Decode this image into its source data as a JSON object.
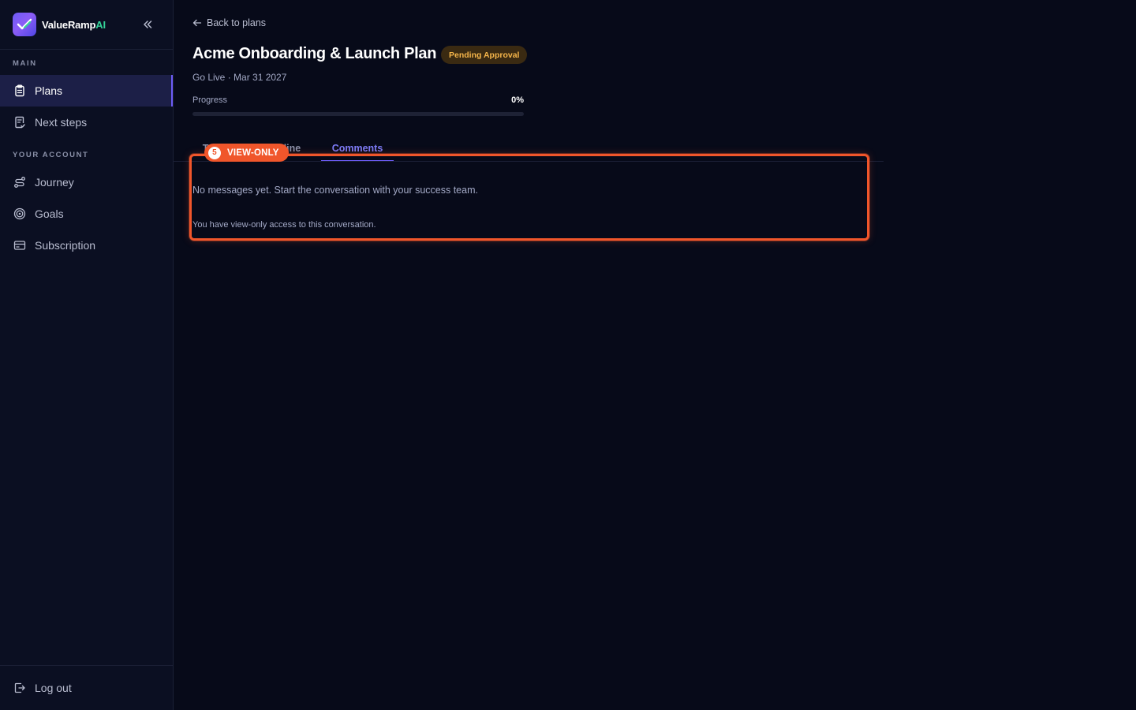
{
  "brand": {
    "name_main": "ValueRamp",
    "name_accent": "AI"
  },
  "sidebar": {
    "section_main": "MAIN",
    "section_account": "YOUR ACCOUNT",
    "items": [
      {
        "label": "Plans",
        "icon": "clipboard-icon",
        "active": true
      },
      {
        "label": "Next steps",
        "icon": "checklist-icon",
        "active": false
      },
      {
        "label": "Journey",
        "icon": "route-icon",
        "active": false
      },
      {
        "label": "Goals",
        "icon": "target-icon",
        "active": false
      },
      {
        "label": "Subscription",
        "icon": "card-icon",
        "active": false
      }
    ],
    "logout": {
      "label": "Log out",
      "icon": "logout-icon"
    }
  },
  "page": {
    "back_label": "Back to plans",
    "title": "Acme Onboarding & Launch Plan",
    "status_badge": "Pending Approval",
    "subtitle": "Go Live · Mar 31 2027",
    "progress_label": "Progress",
    "progress_value": "0%",
    "progress_fraction": 0
  },
  "tabs": [
    {
      "label": "Tasks",
      "active": false
    },
    {
      "label": "Timeline",
      "active": false
    },
    {
      "label": "Comments",
      "active": true
    }
  ],
  "comments": {
    "empty_message": "No messages yet. Start the conversation with your success team.",
    "access_note": "You have view-only access to this conversation."
  },
  "highlight": {
    "number": "5",
    "label": "VIEW-ONLY",
    "color": "#f0562b"
  },
  "colors": {
    "accent": "#6d5cf6",
    "background": "#070a19",
    "sidebar": "#0b0f22",
    "badge_text": "#f5b54a",
    "brand_ai": "#34d399"
  }
}
